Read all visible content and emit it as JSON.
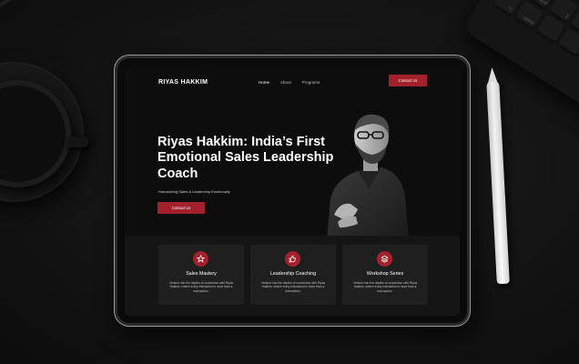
{
  "site": {
    "logo": "RIYAS HAKKIM",
    "nav": [
      {
        "label": "Home",
        "active": true
      },
      {
        "label": "About",
        "active": false
      },
      {
        "label": "Programs",
        "active": false
      }
    ],
    "nav_cta": "Contact Us"
  },
  "hero": {
    "title": "Riyas Hakkim: India’s First Emotional Sales Leadership Coach",
    "subtitle": "Humanizing Sales & Leadership Emotionally",
    "cta": "Contact Us"
  },
  "services": [
    {
      "icon": "star-icon",
      "title": "Sales Mastery",
      "text": "Venture into the depths of connection with Riyas Hakkim, where every interaction is more than a transaction."
    },
    {
      "icon": "thumbs-up-icon",
      "title": "Leadership Coaching",
      "text": "Venture into the depths of connection with Riyas Hakkim, where every interaction is more than a transaction."
    },
    {
      "icon": "stack-icon",
      "title": "Workshop Series",
      "text": "Venture into the depths of connection with Riyas Hakkim, where every interaction is more than a transaction."
    }
  ],
  "keyboard_keys": [
    "⌘",
    "command",
    "Z",
    "X",
    "⌥",
    "option"
  ],
  "colors": {
    "accent": "#a3212c",
    "background": "#0d0d0d",
    "card": "#1f1f1f"
  }
}
